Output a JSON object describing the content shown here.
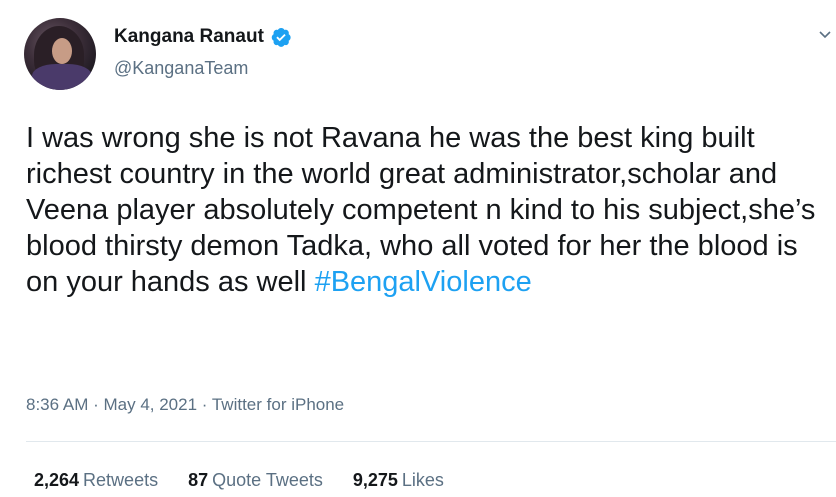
{
  "author": {
    "name": "Kangana Ranaut",
    "handle": "@KanganaTeam",
    "verified_icon": "verified-badge-icon"
  },
  "tweet": {
    "text": "I was wrong she is not Ravana he was the best king built richest country in the world great administrator,scholar and Veena player absolutely competent n kind to his subject,she’s blood thirsty demon Tadka, who all voted for her the blood is on your hands as well ",
    "hashtag": "#BengalViolence"
  },
  "meta": {
    "time": "8:36 AM",
    "sep1": " · ",
    "date": "May 4, 2021",
    "sep2": " · ",
    "source": "Twitter for iPhone"
  },
  "stats": {
    "retweets": "2,264",
    "retweets_label": "Retweets",
    "quotes": "87",
    "quotes_label": "Quote Tweets",
    "likes": "9,275",
    "likes_label": "Likes"
  },
  "colors": {
    "accent": "#1da1f2",
    "secondary_text": "#5b7083",
    "primary_text": "#14171a"
  }
}
